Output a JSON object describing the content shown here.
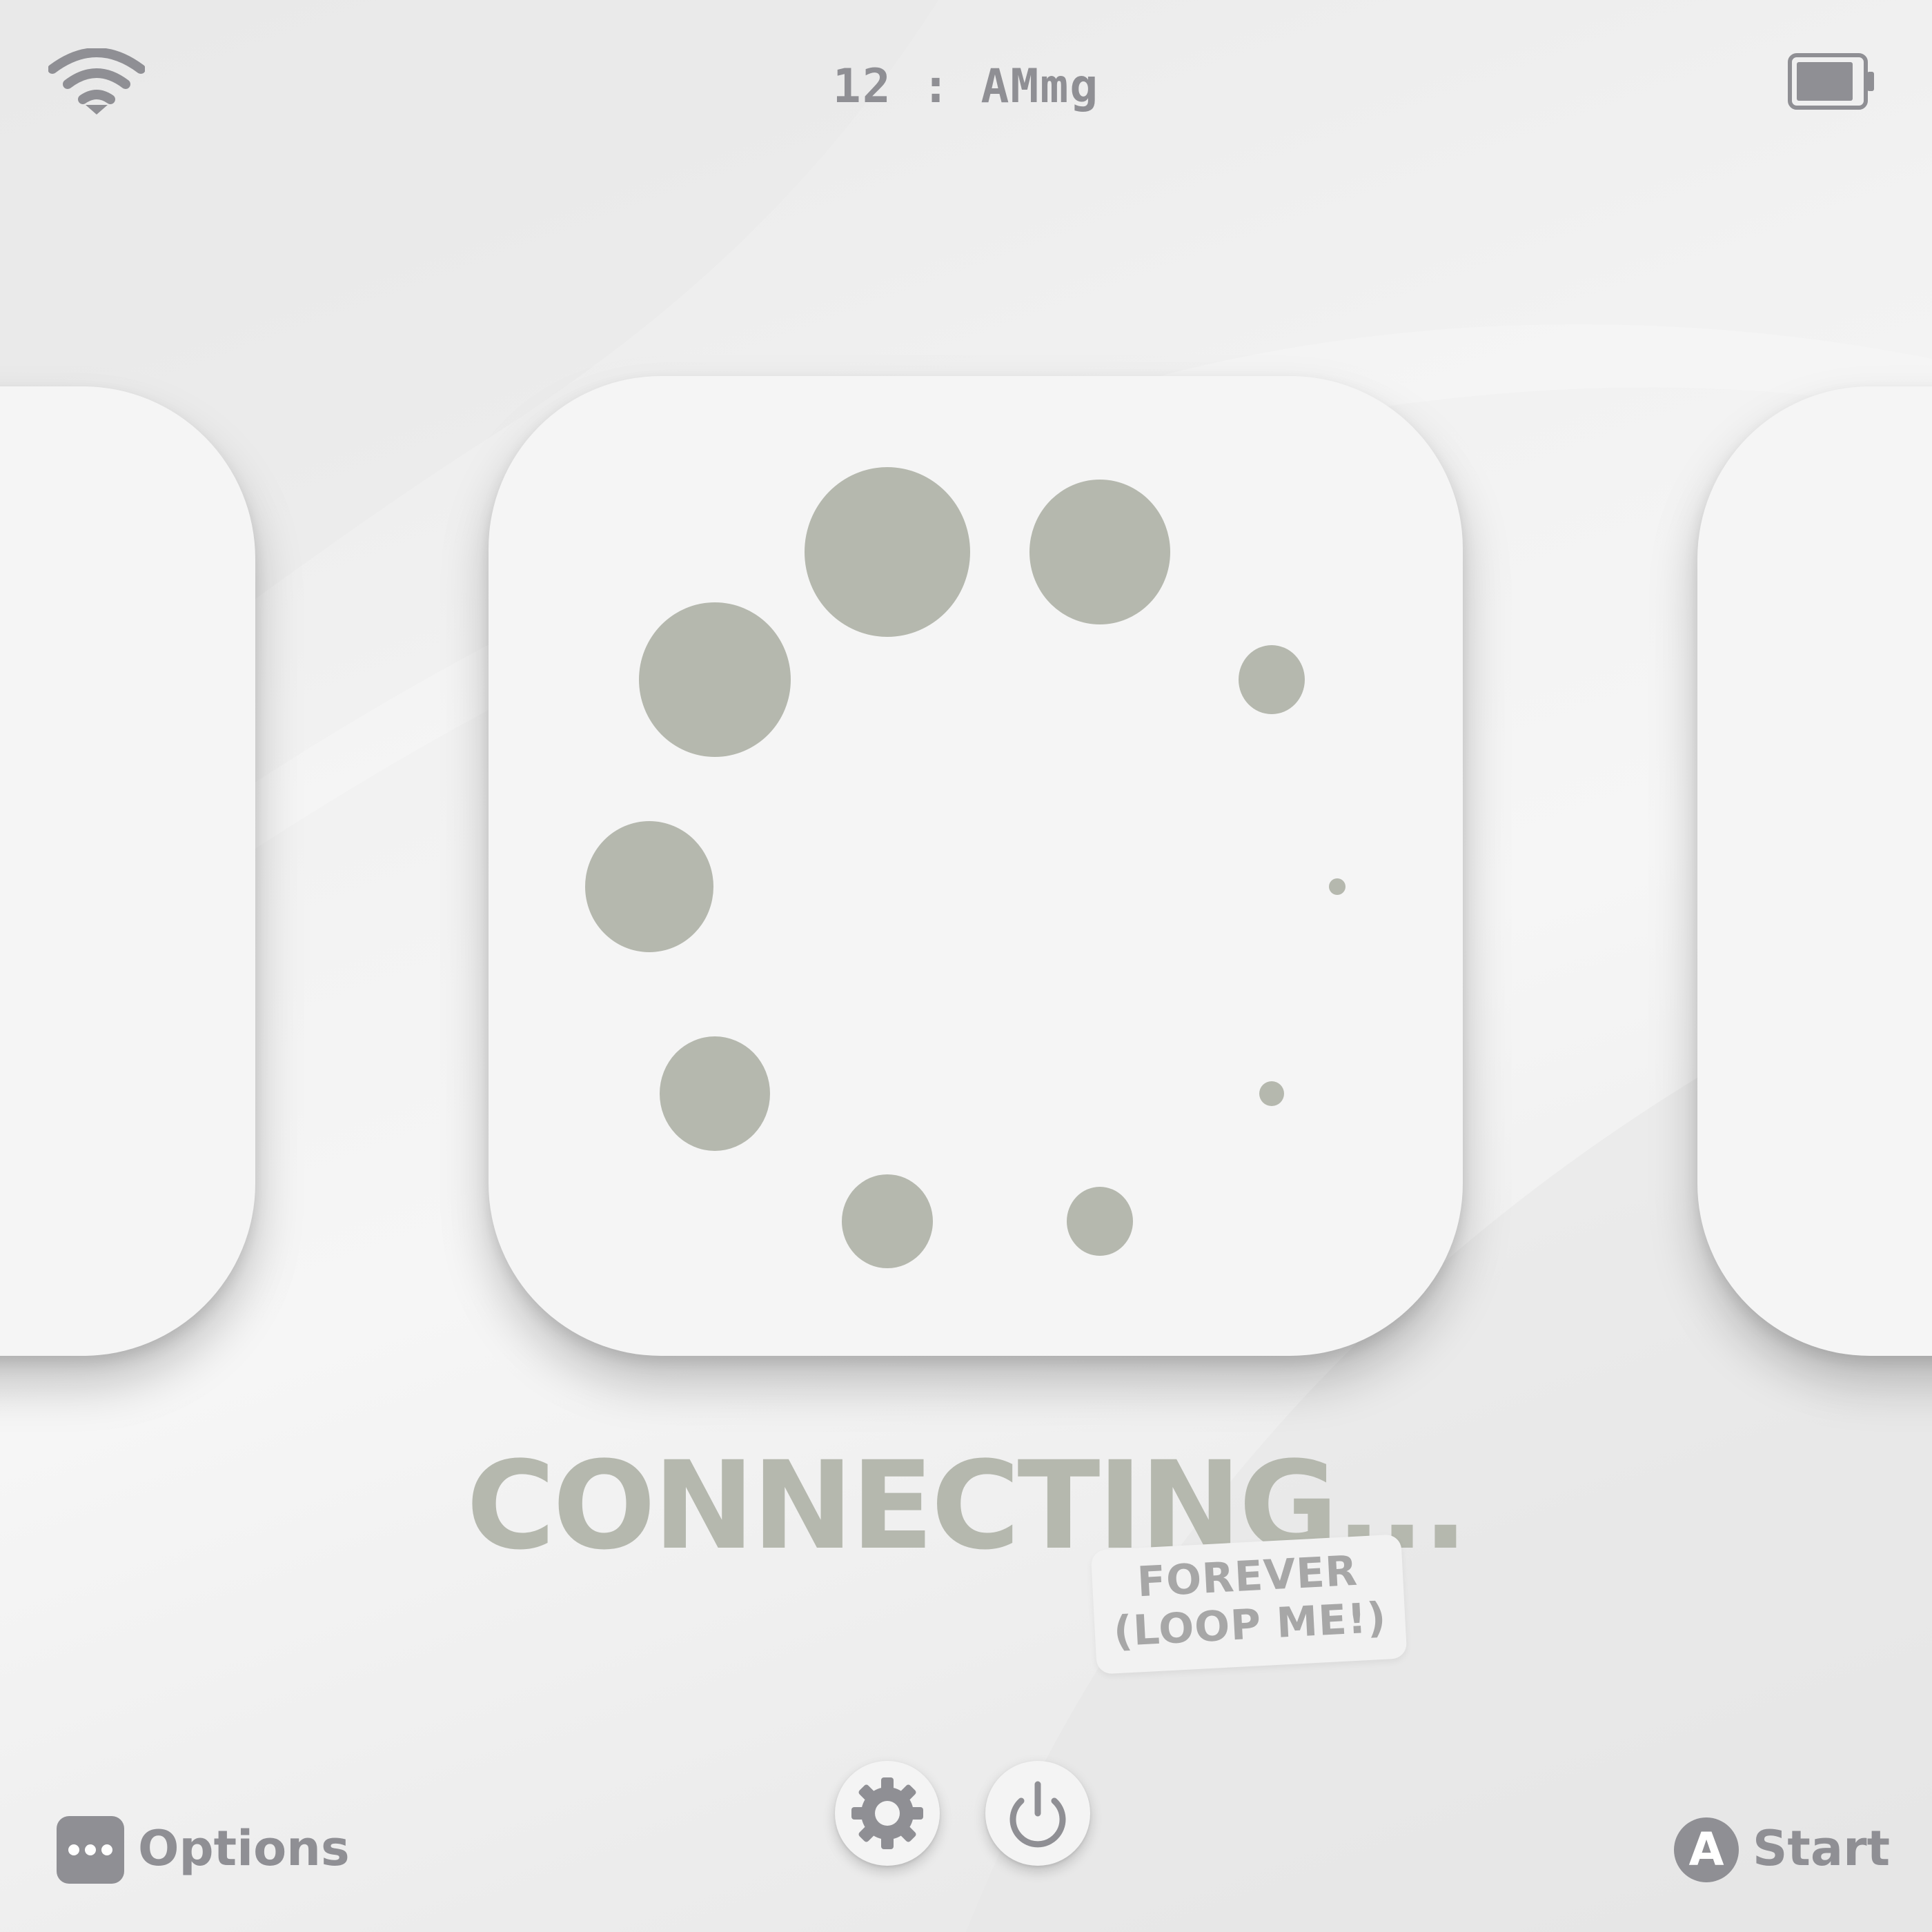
{
  "status_bar": {
    "clock": "12 : AMmg",
    "wifi_icon": "wifi-icon",
    "battery_icon": "battery-icon",
    "battery_level": 0.9
  },
  "main": {
    "title": "CONNECTING...",
    "sticker_line1": "FOREVER",
    "sticker_line2": "(LOOP ME!)",
    "spinner_icon": "loading-spinner-icon"
  },
  "controls": {
    "settings_icon": "gear-icon",
    "power_icon": "power-icon"
  },
  "footer": {
    "options_label": "Options",
    "options_icon": "more-dots-icon",
    "start_key": "A",
    "start_label": "Start"
  },
  "colors": {
    "accent_gray": "#8f8f94",
    "spinner_sage": "#b5b8ae",
    "card_bg": "#f5f5f5",
    "sticker_text": "#a7a7a7"
  }
}
